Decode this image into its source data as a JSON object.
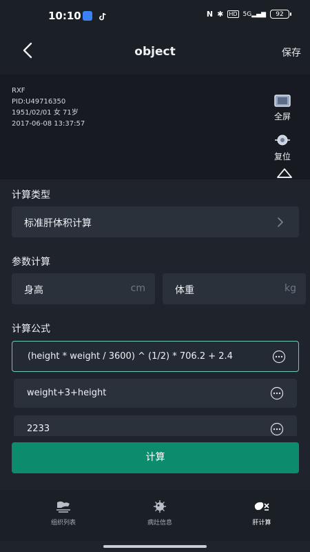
{
  "status_bar": {
    "time": "10:10",
    "battery": "92",
    "hd": "HD",
    "signal": "5G"
  },
  "header": {
    "title": "object",
    "save_label": "保存"
  },
  "patient": {
    "name": "RXF",
    "pid": "PID:U49716350",
    "dob_info": "1951/02/01 女 71岁",
    "datetime": "2017-06-08 13:37:57"
  },
  "tools": {
    "fullscreen_label": "全屏",
    "reset_label": "复位"
  },
  "calc_type": {
    "heading": "计算类型",
    "value": "标准肝体积计算"
  },
  "params": {
    "heading": "参数计算",
    "height_label": "身高",
    "height_unit": "cm",
    "weight_label": "体重",
    "weight_unit": "kg"
  },
  "formulas": {
    "heading": "计算公式",
    "items": [
      "(height * weight / 3600) ^ (1/2) * 706.2 + 2.4",
      "weight+3+height",
      "2233"
    ]
  },
  "compute_label": "计算",
  "nav": [
    {
      "label": "组织列表"
    },
    {
      "label": "病灶信息"
    },
    {
      "label": "肝计算"
    }
  ]
}
